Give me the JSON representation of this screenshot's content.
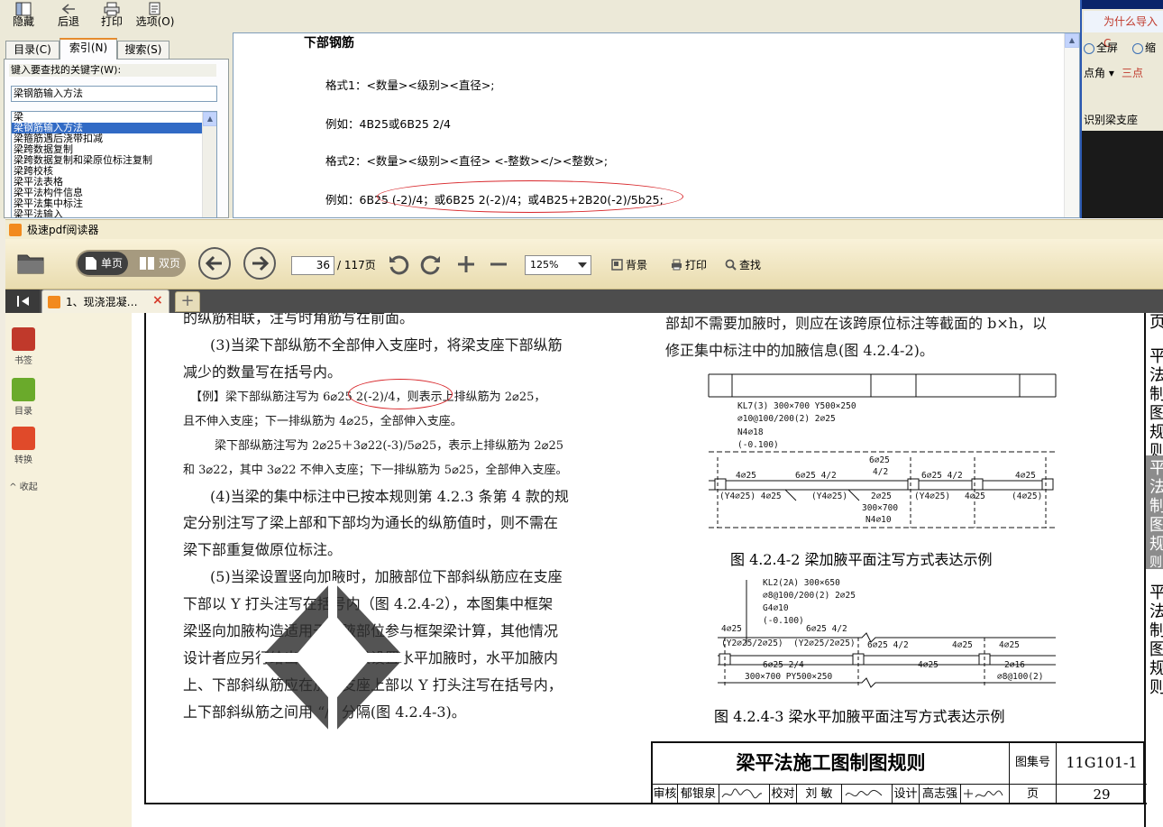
{
  "help_window": {
    "toolbar": [
      {
        "label": "隐藏",
        "icon": "hide-icon"
      },
      {
        "label": "后退",
        "icon": "back-arrow-icon"
      },
      {
        "label": "打印",
        "icon": "printer-icon"
      },
      {
        "label": "选项(O)",
        "icon": "options-icon"
      }
    ],
    "tabs": [
      "目录(C)",
      "索引(N)",
      "搜索(S)"
    ],
    "active_tab": "索引(N)",
    "keyword_label": "键入要查找的关键字(W):",
    "keyword_value": "梁钢筋输入方法",
    "keyword_list": [
      "梁",
      "梁钢筋输入方法",
      "梁箍筋遇后浇带扣减",
      "梁跨数据复制",
      "梁跨数据复制和梁原位标注复制",
      "梁跨校核",
      "梁平法表格",
      "梁平法构件信息",
      "梁平法集中标注",
      "梁平法输入"
    ],
    "selected_index": 1,
    "content": {
      "title": "下部钢筋",
      "lines": [
        "格式1：<数量><级别><直径>;",
        "例如：4B25或6B25 2/4",
        "格式2：<数量><级别><直径> <-整数></><整数>;",
        "例如：6B25 (-2)/4；或6B25 2(-2)/4；或4B25+2B20(-2)/5b25;"
      ]
    }
  },
  "right_app": {
    "title_text": "为什么导入C",
    "tools": [
      {
        "label": "全屏",
        "icon": "zoom-in-icon"
      },
      {
        "label": "缩",
        "icon": "zoom-out-icon"
      },
      {
        "label": "点角",
        "icon": "dropdown-icon"
      },
      {
        "label": "三点",
        "icon": "three-point-icon"
      },
      {
        "label": "识别梁支座",
        "icon": "identify-support-icon"
      }
    ]
  },
  "pdf_reader": {
    "app_title": "极速pdf阅读器",
    "toolbar": {
      "single_page": "单页",
      "double_page": "双页",
      "page_current": "36",
      "page_total": "/ 117页",
      "zoom": "125%",
      "background": "背景",
      "print": "打印",
      "find": "查找"
    },
    "tab_title": "1、现浇混凝…",
    "sidebar": [
      {
        "label": "书签",
        "icon": "bookmark-icon",
        "color": "#c0392b"
      },
      {
        "label": "目录",
        "icon": "toc-icon",
        "color": "#6aaa2b"
      },
      {
        "label": "转换",
        "icon": "pdf-to-word-icon",
        "color": "#e04a2a"
      }
    ],
    "collapse_label": "收起"
  },
  "page": {
    "left_paragraphs": [
      "的纵筋相联，注写时角筋写在前面。",
      "(3)当梁下部纵筋不全部伸入支座时，将梁支座下部纵筋",
      "减少的数量写在括号内。",
      "【例】梁下部纵筋注写为 6⌀25 2(-2)/4，则表示上排纵筋为 2⌀25，",
      "且不伸入支座；下一排纵筋为 4⌀25，全部伸入支座。",
      "梁下部纵筋注写为 2⌀25＋3⌀22(-3)/5⌀25，表示上排纵筋为 2⌀25",
      "和 3⌀22，其中 3⌀22 不伸入支座；下一排纵筋为 5⌀25，全部伸入支座。",
      "(4)当梁的集中标注中已按本规则第 4.2.3 条第 4 款的规",
      "定分别注写了梁上部和下部均为通长的纵筋值时，则不需在",
      "梁下部重复做原位标注。",
      "(5)当梁设置竖向加腋时，加腋部位下部斜纵筋应在支座",
      "下部以 Y 打头注写在括号内（图 4.2.4-2），本图集中框架",
      "梁竖向加腋构造适用于加腋部位参与框架梁计算，其他情况",
      "设计者应另行给出构造。当梁设置水平加腋时，水平加腋内",
      "上、下部斜纵筋应在加腋支座上部以 Y 打头注写在括号内，",
      "上下部斜纵筋之间用 “/” 分隔(图 4.2.4-3)。"
    ],
    "right_paragraphs": [
      "部却不需要加腋时，则应在该跨原位标注等截面的 b×h，以",
      "修正集中标注中的加腋信息(图 4.2.4-2)。"
    ],
    "figure1": {
      "caption": "图 4.2.4-2  梁加腋平面注写方式表达示例",
      "labels": {
        "l1": "KL7(3)  300×700  Y500×250",
        "l2": "⌀10@100/200(2)  2⌀25",
        "l3": "N4⌀18",
        "l4": "(-0.100)",
        "top_mid": "6⌀25",
        "top_mid2": "4/2",
        "a1": "4⌀25",
        "a2": "6⌀25  4/2",
        "a3": "6⌀25  4/2",
        "a4": "4⌀25",
        "b1": "(Y4⌀25)  4⌀25",
        "b2": "(Y4⌀25)",
        "b3": "2⌀25",
        "b4": "(Y4⌀25)",
        "b5": "4⌀25",
        "b6": "(4⌀25)",
        "c1": "300×700",
        "c2": "N4⌀10"
      }
    },
    "figure2": {
      "caption": "图 4.2.4-3  梁水平加腋平面注写方式表达示例",
      "labels": {
        "l1": "KL2(2A)  300×650",
        "l2": "⌀8@100/200(2)  2⌀25",
        "l3": "G4⌀10",
        "l4": "(-0.100)",
        "a1": "4⌀25",
        "a2": "6⌀25  4/2",
        "a3": "6⌀25  4/2",
        "a4": "4⌀25",
        "a5": "4⌀25",
        "b1": "(Y2⌀25/2⌀25)",
        "b2": "(Y2⌀25/2⌀25)",
        "b3": "4⌀25",
        "c1": "6⌀25  2/4",
        "c2": "300×700  PY500×250",
        "c3": "2⌀16",
        "c4": "⌀8@100(2)"
      }
    },
    "title_block": {
      "title": "梁平法施工图制图规则",
      "atlas_label": "图集号",
      "atlas_no": "11G101-1",
      "review": "审核",
      "reviewer": "郁银泉",
      "check": "校对",
      "checker": "刘  敏",
      "design": "设计",
      "designer": "高志强",
      "page_label": "页",
      "page_no": "29"
    },
    "right_edge_chars": [
      "页",
      "平",
      "法",
      "制",
      "图",
      "规",
      "则",
      "平",
      "法",
      "制",
      "图",
      "规",
      "则",
      "平",
      "法",
      "制",
      "图",
      "规",
      "则"
    ]
  }
}
